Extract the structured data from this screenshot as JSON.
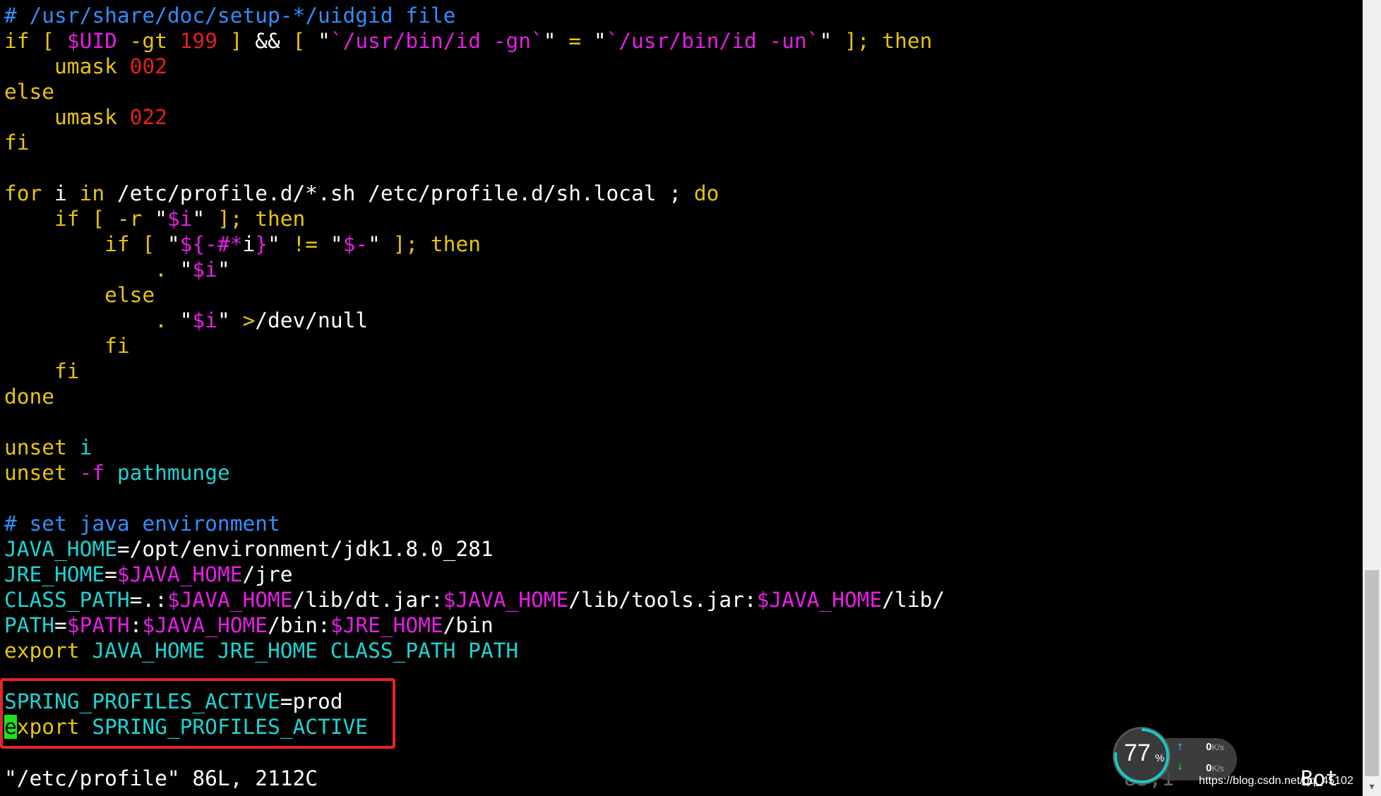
{
  "editor": {
    "lines": [
      [
        {
          "t": "# /usr/share/doc/setup-*/uidgid file",
          "c": "#2f8fff"
        }
      ],
      [
        {
          "t": "if [ ",
          "c": "#e6c40e"
        },
        {
          "t": "$UID",
          "c": "#e61ee6"
        },
        {
          "t": " -gt ",
          "c": "#e6c40e"
        },
        {
          "t": "199",
          "c": "#e61e1e"
        },
        {
          "t": " ] ",
          "c": "#e6c40e"
        },
        {
          "t": "&&",
          "c": "#ffffff"
        },
        {
          "t": " [ ",
          "c": "#e6c40e"
        },
        {
          "t": "\"",
          "c": "#ffffff"
        },
        {
          "t": "`/usr/bin/id -gn`",
          "c": "#e61ee6"
        },
        {
          "t": "\"",
          "c": "#ffffff"
        },
        {
          "t": " = ",
          "c": "#e6c40e"
        },
        {
          "t": "\"",
          "c": "#ffffff"
        },
        {
          "t": "`/usr/bin/id -un`",
          "c": "#e61ee6"
        },
        {
          "t": "\"",
          "c": "#ffffff"
        },
        {
          "t": " ]; then",
          "c": "#e6c40e"
        }
      ],
      [
        {
          "t": "    umask ",
          "c": "#e6c40e"
        },
        {
          "t": "002",
          "c": "#e61e1e"
        }
      ],
      [
        {
          "t": "else",
          "c": "#e6c40e"
        }
      ],
      [
        {
          "t": "    umask ",
          "c": "#e6c40e"
        },
        {
          "t": "022",
          "c": "#e61e1e"
        }
      ],
      [
        {
          "t": "fi",
          "c": "#e6c40e"
        }
      ],
      [],
      [
        {
          "t": "for",
          "c": "#e6c40e"
        },
        {
          "t": " i ",
          "c": "#ffffff"
        },
        {
          "t": "in",
          "c": "#e6c40e"
        },
        {
          "t": " /etc/profile.d/*.sh /etc/profile.d/sh.local ; ",
          "c": "#ffffff"
        },
        {
          "t": "do",
          "c": "#e6c40e"
        }
      ],
      [
        {
          "t": "    if [ -r ",
          "c": "#e6c40e"
        },
        {
          "t": "\"",
          "c": "#ffffff"
        },
        {
          "t": "$i",
          "c": "#e61ee6"
        },
        {
          "t": "\"",
          "c": "#ffffff"
        },
        {
          "t": " ]; then",
          "c": "#e6c40e"
        }
      ],
      [
        {
          "t": "        if [ ",
          "c": "#e6c40e"
        },
        {
          "t": "\"",
          "c": "#ffffff"
        },
        {
          "t": "${-#*",
          "c": "#e61ee6"
        },
        {
          "t": "i",
          "c": "#ffffff"
        },
        {
          "t": "}",
          "c": "#e61ee6"
        },
        {
          "t": "\"",
          "c": "#ffffff"
        },
        {
          "t": " != ",
          "c": "#e6c40e"
        },
        {
          "t": "\"",
          "c": "#ffffff"
        },
        {
          "t": "$-",
          "c": "#e61ee6"
        },
        {
          "t": "\"",
          "c": "#ffffff"
        },
        {
          "t": " ]; then",
          "c": "#e6c40e"
        }
      ],
      [
        {
          "t": "            . ",
          "c": "#e6c40e"
        },
        {
          "t": "\"",
          "c": "#ffffff"
        },
        {
          "t": "$i",
          "c": "#e61ee6"
        },
        {
          "t": "\"",
          "c": "#ffffff"
        }
      ],
      [
        {
          "t": "        else",
          "c": "#e6c40e"
        }
      ],
      [
        {
          "t": "            . ",
          "c": "#e6c40e"
        },
        {
          "t": "\"",
          "c": "#ffffff"
        },
        {
          "t": "$i",
          "c": "#e61ee6"
        },
        {
          "t": "\"",
          "c": "#ffffff"
        },
        {
          "t": " >",
          "c": "#e6c40e"
        },
        {
          "t": "/dev/null",
          "c": "#ffffff"
        }
      ],
      [
        {
          "t": "        fi",
          "c": "#e6c40e"
        }
      ],
      [
        {
          "t": "    fi",
          "c": "#e6c40e"
        }
      ],
      [
        {
          "t": "done",
          "c": "#e6c40e"
        }
      ],
      [],
      [
        {
          "t": "unset",
          "c": "#e6c40e"
        },
        {
          "t": " i",
          "c": "#1ed2d2"
        }
      ],
      [
        {
          "t": "unset",
          "c": "#e6c40e"
        },
        {
          "t": " -f",
          "c": "#e61ee6"
        },
        {
          "t": " pathmunge",
          "c": "#1ed2d2"
        }
      ],
      [],
      [
        {
          "t": "# set java environment",
          "c": "#2f8fff"
        }
      ],
      [
        {
          "t": "JAVA_HOME",
          "c": "#1ed2d2"
        },
        {
          "t": "=/opt/environment/jdk1.8.0_281",
          "c": "#ffffff"
        }
      ],
      [
        {
          "t": "JRE_HOME",
          "c": "#1ed2d2"
        },
        {
          "t": "=",
          "c": "#ffffff"
        },
        {
          "t": "$JAVA_HOME",
          "c": "#e61ee6"
        },
        {
          "t": "/jre",
          "c": "#ffffff"
        }
      ],
      [
        {
          "t": "CLASS_PATH",
          "c": "#1ed2d2"
        },
        {
          "t": "=.:",
          "c": "#ffffff"
        },
        {
          "t": "$JAVA_HOME",
          "c": "#e61ee6"
        },
        {
          "t": "/lib/dt.jar:",
          "c": "#ffffff"
        },
        {
          "t": "$JAVA_HOME",
          "c": "#e61ee6"
        },
        {
          "t": "/lib/tools.jar:",
          "c": "#ffffff"
        },
        {
          "t": "$JAVA_HOME",
          "c": "#e61ee6"
        },
        {
          "t": "/lib/",
          "c": "#ffffff"
        }
      ],
      [
        {
          "t": "PATH",
          "c": "#1ed2d2"
        },
        {
          "t": "=",
          "c": "#ffffff"
        },
        {
          "t": "$PATH",
          "c": "#e61ee6"
        },
        {
          "t": ":",
          "c": "#ffffff"
        },
        {
          "t": "$JAVA_HOME",
          "c": "#e61ee6"
        },
        {
          "t": "/bin:",
          "c": "#ffffff"
        },
        {
          "t": "$JRE_HOME",
          "c": "#e61ee6"
        },
        {
          "t": "/bin",
          "c": "#ffffff"
        }
      ],
      [
        {
          "t": "export",
          "c": "#e6c40e"
        },
        {
          "t": " JAVA_HOME JRE_HOME CLASS_PATH PATH",
          "c": "#1ed2d2"
        }
      ],
      [],
      [
        {
          "t": "SPRING_PROFILES_ACTIVE",
          "c": "#1ed2d2"
        },
        {
          "t": "=prod",
          "c": "#ffffff"
        }
      ],
      [
        {
          "t": "e",
          "c": "#000000",
          "cursor": true
        },
        {
          "t": "xport",
          "c": "#e6c40e"
        },
        {
          "t": " SPRING_PROFILES_ACTIVE",
          "c": "#1ed2d2"
        }
      ]
    ]
  },
  "status": {
    "file_info": "\"/etc/profile\" 86L, 2112C",
    "position": "85,1",
    "scroll": "Bot"
  },
  "net_monitor": {
    "percent": "77",
    "percent_sign": "%",
    "upload_value": "0",
    "download_value": "0",
    "unit": "K/s",
    "up_arrow": "↑",
    "down_arrow": "↓",
    "up_color": "#2fa8ff",
    "down_color": "#1ec81e",
    "arc_color": "#19c8c8",
    "arc_fraction": 0.77
  },
  "watermark": "https://blog.csdn.net/qq_45102"
}
